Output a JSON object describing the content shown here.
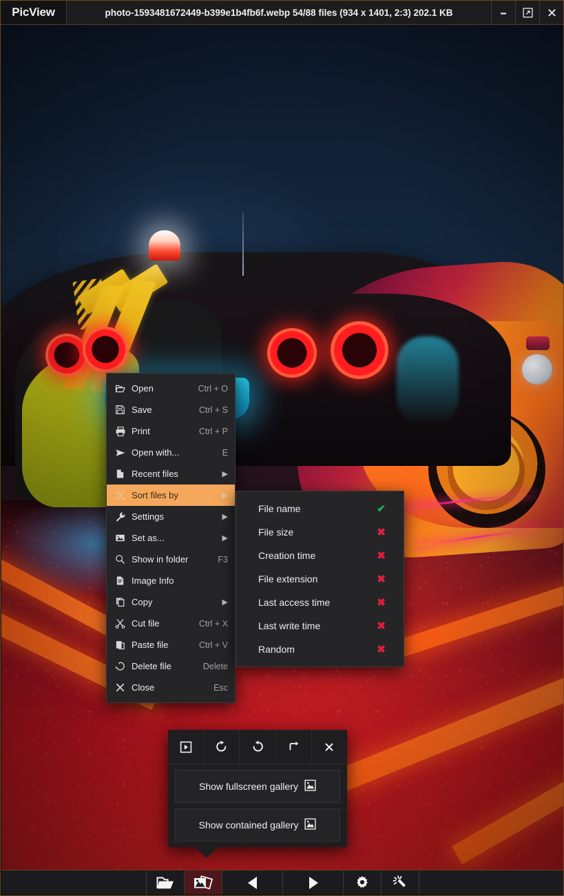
{
  "app": {
    "name": "PicView"
  },
  "titlebar": {
    "title": "photo-1593481672449-b399e1b4fb6f.webp 54/88 files (934 x 1401, 2:3) 202.1 KB",
    "file_name": "photo-1593481672449-b399e1b4fb6f.webp",
    "file_index": "54/88 files",
    "dimensions": "934 x 1401",
    "aspect_ratio": "2:3",
    "file_size": "202.1 KB",
    "buttons": [
      {
        "name": "minimize",
        "glyph": "minimize-icon"
      },
      {
        "name": "restore",
        "glyph": "external-link-icon"
      },
      {
        "name": "close",
        "glyph": "close-icon"
      }
    ]
  },
  "context_menu": {
    "items": [
      {
        "label": "Open",
        "accel": "Ctrl + O",
        "icon": "folder-open-icon",
        "submenu": false,
        "highlighted": false
      },
      {
        "label": "Save",
        "accel": "Ctrl + S",
        "icon": "save-icon",
        "submenu": false,
        "highlighted": false
      },
      {
        "label": "Print",
        "accel": "Ctrl + P",
        "icon": "printer-icon",
        "submenu": false,
        "highlighted": false
      },
      {
        "label": "Open with...",
        "accel": "E",
        "icon": "send-icon",
        "submenu": false,
        "highlighted": false
      },
      {
        "label": "Recent files",
        "accel": "",
        "icon": "file-icon",
        "submenu": true,
        "highlighted": false
      },
      {
        "label": "Sort files by",
        "accel": "",
        "icon": "shuffle-icon",
        "submenu": true,
        "highlighted": true
      },
      {
        "label": "Settings",
        "accel": "",
        "icon": "wrench-icon",
        "submenu": true,
        "highlighted": false
      },
      {
        "label": "Set as...",
        "accel": "",
        "icon": "image-icon",
        "submenu": true,
        "highlighted": false
      },
      {
        "label": "Show in folder",
        "accel": "F3",
        "icon": "search-icon",
        "submenu": false,
        "highlighted": false
      },
      {
        "label": "Image Info",
        "accel": "",
        "icon": "document-icon",
        "submenu": false,
        "highlighted": false
      },
      {
        "label": "Copy",
        "accel": "",
        "icon": "copy-icon",
        "submenu": true,
        "highlighted": false
      },
      {
        "label": "Cut file",
        "accel": "Ctrl + X",
        "icon": "scissors-icon",
        "submenu": false,
        "highlighted": false
      },
      {
        "label": "Paste file",
        "accel": "Ctrl + V",
        "icon": "paste-icon",
        "submenu": false,
        "highlighted": false
      },
      {
        "label": "Delete file",
        "accel": "Delete",
        "icon": "recycle-icon",
        "submenu": false,
        "highlighted": false
      },
      {
        "label": "Close",
        "accel": "Esc",
        "icon": "close-icon",
        "submenu": false,
        "highlighted": false
      }
    ]
  },
  "sort_submenu": {
    "items": [
      {
        "label": "File name",
        "selected": true,
        "mark": "✔"
      },
      {
        "label": "File size",
        "selected": false,
        "mark": "✖"
      },
      {
        "label": "Creation time",
        "selected": false,
        "mark": "✖"
      },
      {
        "label": "File extension",
        "selected": false,
        "mark": "✖"
      },
      {
        "label": "Last access time",
        "selected": false,
        "mark": "✖"
      },
      {
        "label": "Last write time",
        "selected": false,
        "mark": "✖"
      },
      {
        "label": "Random",
        "selected": false,
        "mark": "✖"
      }
    ]
  },
  "gallery_popup": {
    "toolbar": [
      {
        "name": "slideshow-icon"
      },
      {
        "name": "rotate-right-icon"
      },
      {
        "name": "rotate-left-icon"
      },
      {
        "name": "flip-icon"
      },
      {
        "name": "close-icon"
      }
    ],
    "items": [
      {
        "label": "Show fullscreen gallery",
        "icon": "image-icon"
      },
      {
        "label": "Show contained gallery",
        "icon": "image-icon"
      }
    ]
  },
  "bottom_toolbar": {
    "buttons": [
      {
        "name": "open-folder-icon",
        "active": false
      },
      {
        "name": "gallery-icon",
        "active": true
      },
      {
        "name": "previous-icon",
        "active": false
      },
      {
        "name": "next-icon",
        "active": false
      },
      {
        "name": "settings-icon",
        "active": false
      },
      {
        "name": "effects-icon",
        "active": false
      }
    ]
  },
  "colors": {
    "highlight": "#f5a85c",
    "menu_bg": "#252527",
    "titlebar_bg": "#1c1c1e",
    "accent_border": "#5b3f1e",
    "check_green": "#22b24c",
    "cross_red": "#e01f3d"
  }
}
